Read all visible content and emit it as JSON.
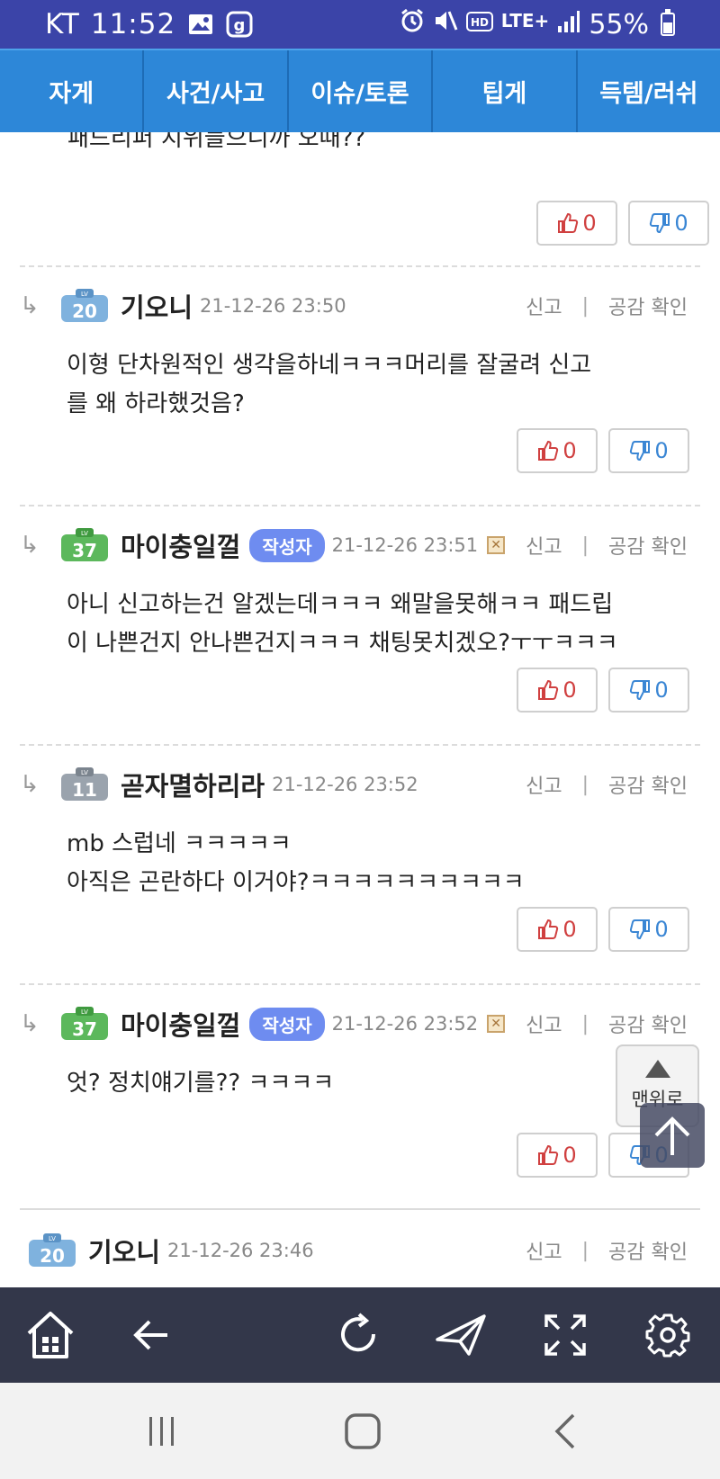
{
  "status_bar": {
    "carrier": "KT",
    "time": "11:52",
    "network": "LTE",
    "network_plus": "+",
    "battery": "55%",
    "icons": [
      "gallery-icon",
      "g-app-icon",
      "alarm-icon",
      "mute-icon",
      "hd-voice-icon",
      "lte-icon",
      "signal-icon",
      "battery-icon"
    ]
  },
  "tabs": [
    "자게",
    "사건/사고",
    "이슈/토론",
    "팁게",
    "득템/러쉬"
  ],
  "cut_comment": {
    "text": "패드리퍼 지위들으니까 오때??",
    "up": "0",
    "down": "0"
  },
  "comments": [
    {
      "level": "20",
      "author": "기오니",
      "timestamp": "21-12-26 23:50",
      "is_writer": false,
      "lines": [
        "이형 단차원적인 생각을하네ㅋㅋㅋ머리를 잘굴려 신고",
        "를 왜 하라했것음?"
      ],
      "up": "0",
      "down": "0"
    },
    {
      "level": "37",
      "author": "마이충일껄",
      "timestamp": "21-12-26 23:51",
      "is_writer": true,
      "lines": [
        "아니 신고하는건 알겠는데ㅋㅋㅋ  왜말을못해ㅋㅋ 패드립",
        "이 나쁜건지 안나쁜건지ㅋㅋㅋ  채팅못치겠오?ㅜㅜㅋㅋㅋ"
      ],
      "up": "0",
      "down": "0"
    },
    {
      "level": "11",
      "author": "곧자멸하리라",
      "timestamp": "21-12-26 23:52",
      "is_writer": false,
      "lines": [
        "mb 스럽네 ㅋㅋㅋㅋㅋ",
        "아직은 곤란하다 이거야?ㅋㅋㅋㅋㅋㅋㅋㅋㅋㅋ"
      ],
      "up": "0",
      "down": "0"
    },
    {
      "level": "37",
      "author": "마이충일껄",
      "timestamp": "21-12-26 23:52",
      "is_writer": true,
      "lines": [
        "엇? 정치얘기를??  ㅋㅋㅋㅋ"
      ],
      "up": "0",
      "down": "0"
    }
  ],
  "last_comment": {
    "level": "20",
    "author": "기오니",
    "timestamp": "21-12-26 23:46"
  },
  "labels": {
    "writer_badge": "작성자",
    "report": "신고",
    "sep": "|",
    "likes_check": "공감 확인",
    "lv": "LV",
    "to_top": "맨위로",
    "reply_arrow": "↳"
  },
  "colors": {
    "status_bar": "#3b44a8",
    "tab_bar": "#2d87d8",
    "toolbar": "#33374a",
    "writer_badge": "#6e8cf0",
    "upvote": "#d04040",
    "downvote": "#3a86d4"
  },
  "toolbar_icons": [
    "home-icon",
    "back-arrow-icon",
    "refresh-icon",
    "send-icon",
    "fullscreen-icon",
    "settings-icon"
  ],
  "nav_icons": [
    "recent-apps-icon",
    "home-button-icon",
    "back-icon"
  ]
}
